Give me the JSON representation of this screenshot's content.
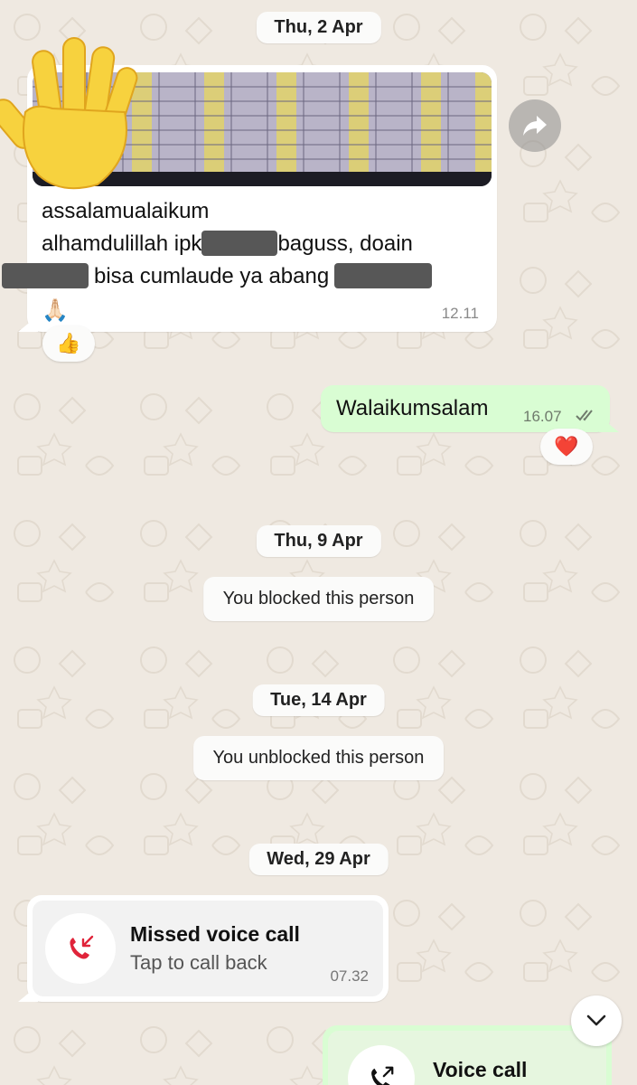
{
  "dates": {
    "first": "Thu, 2 Apr",
    "second": "Thu, 9 Apr",
    "third": "Tue, 14 Apr",
    "fourth": "Wed, 29 Apr"
  },
  "incoming_message": {
    "line1": "assalamualaikum",
    "line2_a": "alhamdulillah ipk",
    "line2_b": "baguss, doain",
    "line3_a": "bisa cumlaude ya abang",
    "emoji": "🙏🏻",
    "time": "12.11",
    "reaction": "👍"
  },
  "outgoing_message": {
    "text": "Walaikumsalam",
    "time": "16.07",
    "reaction": "❤️"
  },
  "system_messages": {
    "blocked": "You blocked this person",
    "unblocked": "You unblocked this person"
  },
  "missed_call": {
    "title": "Missed voice call",
    "subtitle": "Tap to call back",
    "time": "07.32"
  },
  "outgoing_call": {
    "title": "Voice call"
  },
  "colors": {
    "wallpaper": "#efe9e1",
    "outgoing_bubble": "#d9fdd3",
    "missed_call_red": "#e0243a",
    "read_ticks": "#6f7a6c"
  },
  "icons": {
    "forward": "forward-icon",
    "missed_call": "missed-call-icon",
    "outgoing_call": "outgoing-call-icon",
    "scroll_down": "chevron-down-icon",
    "read_receipt": "double-check-icon",
    "sticker": "raised-hand-emoji"
  }
}
